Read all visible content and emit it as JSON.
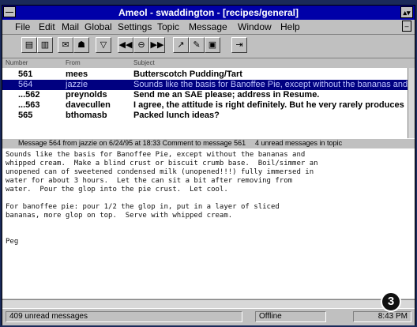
{
  "window": {
    "title": "Ameol - swaddington - [recipes/general]",
    "max_glyph": "▴▾",
    "sys_glyph": "—"
  },
  "menu": [
    "File",
    "Edit",
    "Mail",
    "Global",
    "Settings",
    "Topic",
    "Message",
    "Window",
    "Help"
  ],
  "menu_underline": [
    "F",
    "E",
    "M",
    "G",
    "S",
    "T",
    "a",
    "W",
    "H"
  ],
  "toolbar_icons": [
    "folder-icon",
    "book-icon",
    "mail-icon",
    "person-icon",
    "shield-icon",
    "prev-icon",
    "disk-icon",
    "next-icon",
    "cursor-icon",
    "pen-icon",
    "lock-icon",
    "exit-icon"
  ],
  "list": {
    "headers": [
      "Number",
      "From",
      "Subject"
    ],
    "rows": [
      {
        "flag": "",
        "num": "561",
        "from": "mees",
        "subj": "Butterscotch Pudding/Tart",
        "selected": false
      },
      {
        "flag": "",
        "num": "564",
        "from": "jazzie",
        "subj": "Sounds like the basis for Banoffee Pie, except without the bananas and",
        "selected": true
      },
      {
        "flag": "",
        "num": "...562",
        "from": "preynolds",
        "subj": "Send me an SAE please; address in Resume.",
        "selected": false
      },
      {
        "flag": "",
        "num": "...563",
        "from": "davecullen",
        "subj": "I agree, the attitude is right definitely. But he very rarely produces",
        "selected": false
      },
      {
        "flag": "",
        "num": "565",
        "from": "bthomasb",
        "subj": "Packed lunch ideas?",
        "selected": false
      }
    ]
  },
  "message_status": "Message 564 from jazzie on 6/24/95 at 18:33 Comment to message 561",
  "message_status2": "4 unread messages in topic",
  "message_lines": [
    "Sounds like the basis for Banoffee Pie, except without the bananas and",
    "whipped cream.  Make a blind crust or biscuit crumb base.  Boil/simmer an",
    "unopened can of sweetened condensed milk (unopened!!!) fully immersed in",
    "water for about 3 hours.  Let the can sit a bit after removing from",
    "water.  Pour the glop into the pie crust.  Let cool.",
    "",
    "For banoffee pie: pour 1/2 the glop in, put in a layer of sliced",
    "bananas, more glop on top.  Serve with whipped cream.",
    "",
    "",
    "Peg"
  ],
  "statusbar": {
    "unread": "409 unread messages",
    "online": "Offline",
    "time": "8:43 PM"
  },
  "badge": "3"
}
